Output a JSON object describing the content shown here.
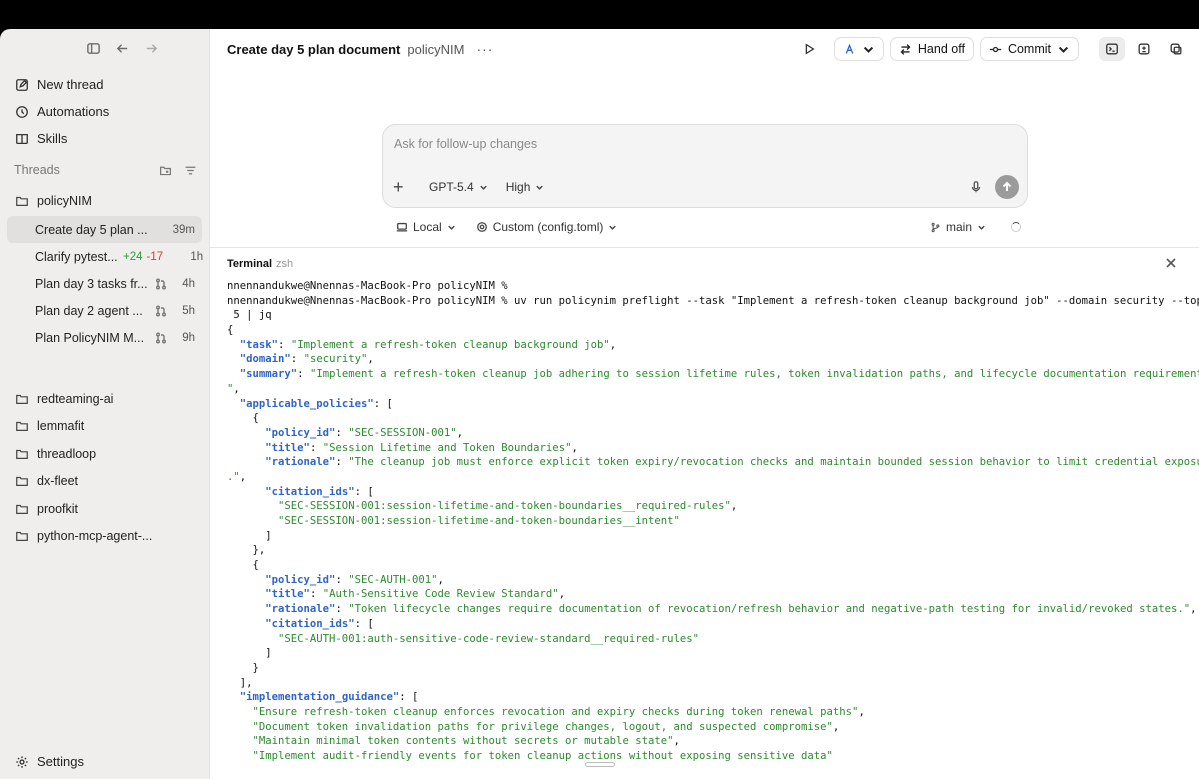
{
  "sidebar": {
    "nav": [
      {
        "label": "New thread",
        "icon": "edit-icon"
      },
      {
        "label": "Automations",
        "icon": "clock-icon"
      },
      {
        "label": "Skills",
        "icon": "book-icon"
      }
    ],
    "threads_header": "Threads",
    "active_project": "policyNIM",
    "threads": [
      {
        "title": "Create day 5 plan ...",
        "age": "39m",
        "active": true
      },
      {
        "title": "Clarify pytest...",
        "diff_add": "+24",
        "diff_del": "-17",
        "age": "1h"
      },
      {
        "title": "Plan day 3 tasks fr...",
        "age": "4h"
      },
      {
        "title": "Plan day 2 agent ...",
        "age": "5h"
      },
      {
        "title": "Plan PolicyNIM M...",
        "age": "9h"
      }
    ],
    "projects": [
      "redteaming-ai",
      "lemmafit",
      "threadloop",
      "dx-fleet",
      "proofkit",
      "python-mcp-agent-..."
    ],
    "settings_label": "Settings"
  },
  "header": {
    "title": "Create day 5 plan document",
    "project": "policyNIM",
    "more": "···",
    "handoff_label": "Hand off",
    "commit_label": "Commit"
  },
  "composer": {
    "placeholder": "Ask for follow-up changes",
    "model": "GPT-5.4",
    "effort": "High"
  },
  "subbar": {
    "env": "Local",
    "config": "Custom (config.toml)",
    "branch": "main"
  },
  "terminal": {
    "title": "Terminal",
    "shell": "zsh",
    "prompt1": "nnennandukwe@Nnennas-MacBook-Pro policyNIM %",
    "prompt2": "nnennandukwe@Nnennas-MacBook-Pro policyNIM % uv run policynim preflight --task \"Implement a refresh-token cleanup background job\" --domain security --top-k",
    "prompt2_cont": " 5 | jq",
    "task": "Implement a refresh-token cleanup background job",
    "domain": "security",
    "summary": "Implement a refresh-token cleanup job adhering to session lifetime rules, token invalidation paths, and lifecycle documentation requirements.",
    "policies": [
      {
        "policy_id": "SEC-SESSION-001",
        "title": "Session Lifetime and Token Boundaries",
        "rationale": "The cleanup job must enforce explicit token expiry/revocation checks and maintain bounded session behavior to limit credential exposure",
        "citation_ids": [
          "SEC-SESSION-001:session-lifetime-and-token-boundaries__required-rules",
          "SEC-SESSION-001:session-lifetime-and-token-boundaries__intent"
        ]
      },
      {
        "policy_id": "SEC-AUTH-001",
        "title": "Auth-Sensitive Code Review Standard",
        "rationale": "Token lifecycle changes require documentation of revocation/refresh behavior and negative-path testing for invalid/revoked states.",
        "citation_ids": [
          "SEC-AUTH-001:auth-sensitive-code-review-standard__required-rules"
        ]
      }
    ],
    "guidance": [
      "Ensure refresh-token cleanup enforces revocation and expiry checks during token renewal paths",
      "Document token invalidation paths for privilege changes, logout, and suspected compromise",
      "Maintain minimal token contents without secrets or mutable state",
      "Implement audit-friendly events for token cleanup actions without exposing sensitive data"
    ]
  }
}
